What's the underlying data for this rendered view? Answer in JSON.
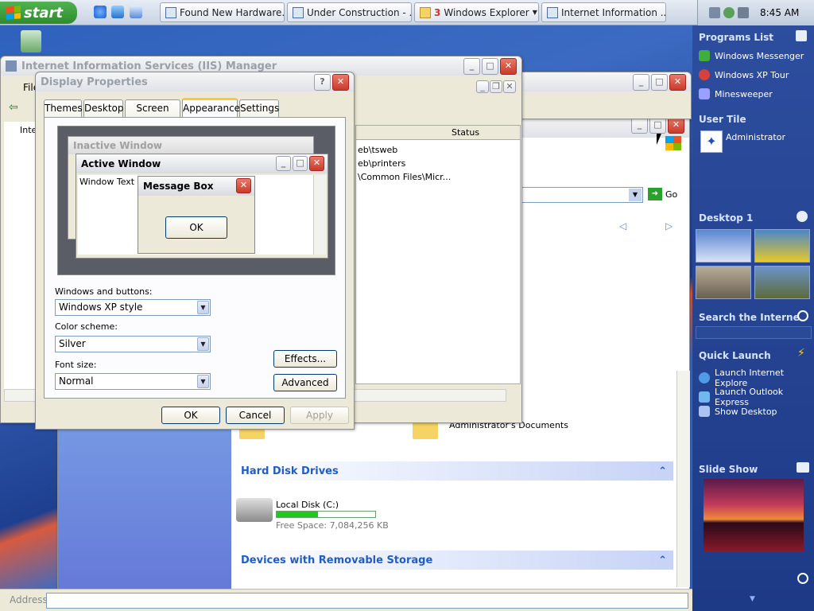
{
  "taskbar": {
    "start_label": "start",
    "tasks": [
      {
        "label": "Found New Hardware..."
      },
      {
        "label": "Under Construction - ..."
      },
      {
        "count": "3",
        "label": "Windows Explorer"
      },
      {
        "label": "Internet Information ..."
      }
    ],
    "clock": "8:45 AM"
  },
  "iis_window": {
    "title": "Internet Information Services (IIS) Manager",
    "menu_first": "File",
    "tree_item": "Inte"
  },
  "explorer_list": {
    "col_status": "Status",
    "rows": [
      "eb\\tsweb",
      "eb\\printers",
      "\\Common Files\\Micr..."
    ]
  },
  "display_props": {
    "title": "Display Properties",
    "tabs": [
      "Themes",
      "Desktop",
      "Screen Saver",
      "Appearance",
      "Settings"
    ],
    "preview": {
      "inactive_title": "Inactive Window",
      "active_title": "Active Window",
      "window_text": "Window Text",
      "msgbox_title": "Message Box",
      "msgbox_ok": "OK"
    },
    "windows_buttons_label": "Windows and buttons:",
    "windows_buttons_value": "Windows XP style",
    "color_scheme_label": "Color scheme:",
    "color_scheme_value": "Silver",
    "font_size_label": "Font size:",
    "font_size_value": "Normal",
    "effects_label": "Effects...",
    "advanced_label": "Advanced",
    "ok_label": "OK",
    "cancel_label": "Cancel",
    "apply_label": "Apply"
  },
  "my_computer": {
    "go_label": "Go",
    "admin_docs": "Administrator's Documents",
    "hard_disk_header": "Hard Disk Drives",
    "local_disk_name": "Local Disk (C:)",
    "free_space": "Free Space: 7,084,256 KB",
    "disk_used_fraction": 0.42,
    "removable_header": "Devices with Removable Storage",
    "address_label": "Address"
  },
  "sidebar": {
    "programs_header": "Programs List",
    "programs": [
      "Windows Messenger",
      "Windows XP Tour",
      "Minesweeper"
    ],
    "user_header": "User Tile",
    "user_name": "Administrator",
    "desktop_header": "Desktop 1",
    "search_header": "Search the Interne",
    "quick_launch_header": "Quick Launch",
    "quick_launch": [
      "Launch Internet Explore",
      "Launch Outlook Express",
      "Show Desktop"
    ],
    "slideshow_header": "Slide Show"
  },
  "colors": {
    "xp_blue": "#215dc6",
    "start_green": "#2e8b2e",
    "sidebar_blue": "#1d3a86",
    "disk_green": "#1ec81e"
  }
}
